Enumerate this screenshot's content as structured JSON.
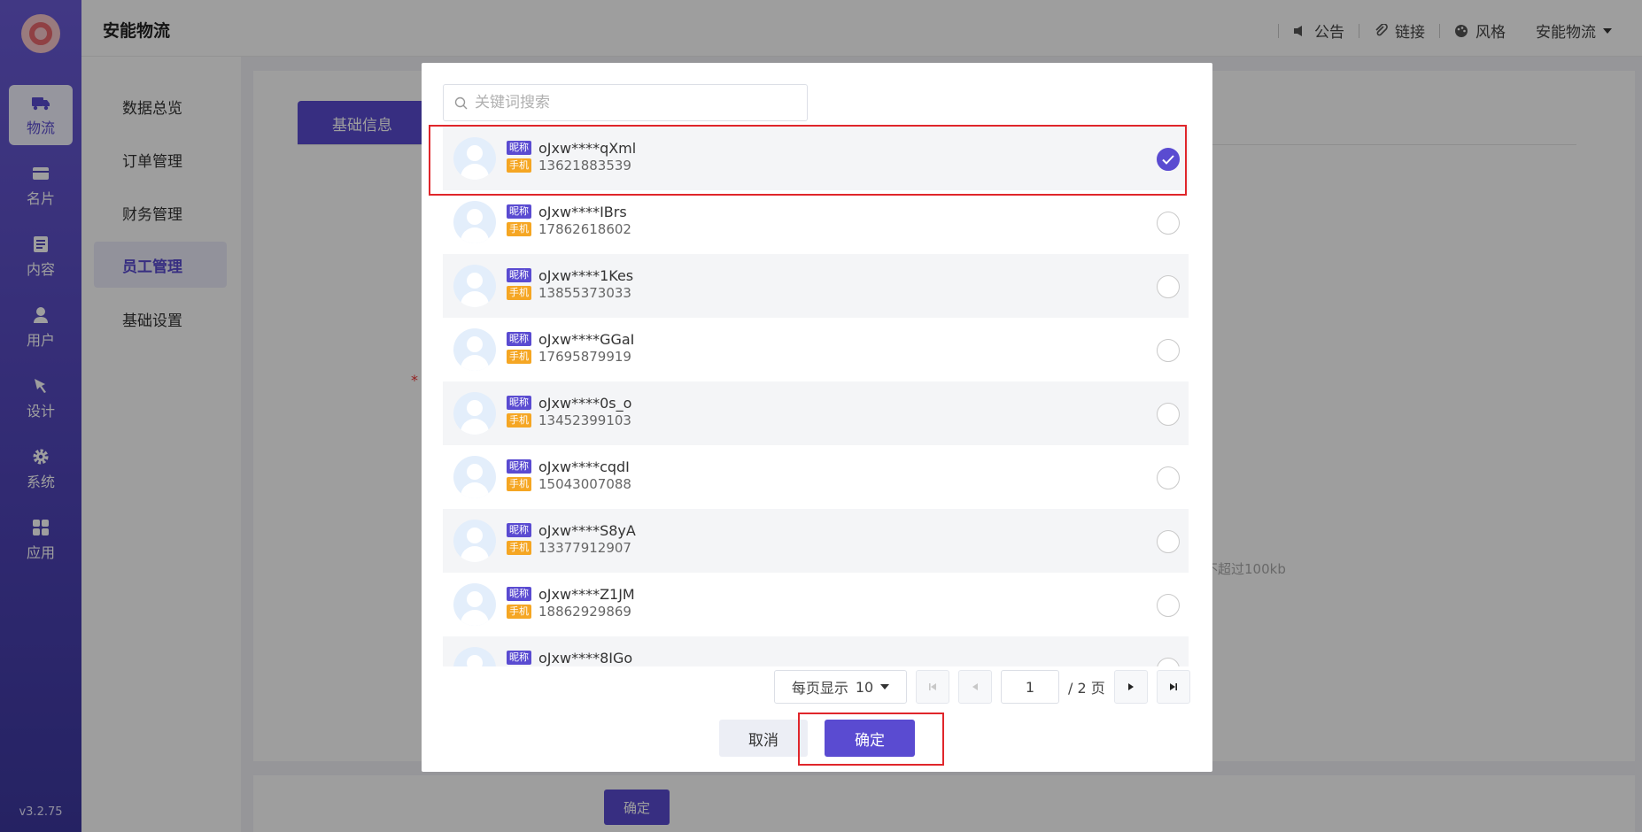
{
  "app": {
    "brand": "安能物流",
    "version": "v3.2.75"
  },
  "rail": [
    {
      "label": "物流",
      "icon": "truck-icon",
      "active": true
    },
    {
      "label": "名片",
      "icon": "card-icon"
    },
    {
      "label": "内容",
      "icon": "document-icon"
    },
    {
      "label": "用户",
      "icon": "user-icon"
    },
    {
      "label": "设计",
      "icon": "design-icon"
    },
    {
      "label": "系统",
      "icon": "gear-icon"
    },
    {
      "label": "应用",
      "icon": "apps-icon"
    }
  ],
  "submenu": [
    "数据总览",
    "订单管理",
    "财务管理",
    "员工管理",
    "基础设置"
  ],
  "submenu_active": "员工管理",
  "header": {
    "notice": "公告",
    "link": "链接",
    "style": "风格",
    "account": "安能物流"
  },
  "page": {
    "tab": "基础信息",
    "required_mark": "*",
    "hint": "不超过100kb",
    "confirm": "确定"
  },
  "modal": {
    "search_placeholder": "关键词搜索",
    "nick_tag": "昵称",
    "phone_tag": "手机",
    "users": [
      {
        "nick": "oJxw****qXml",
        "phone": "13621883539",
        "checked": true
      },
      {
        "nick": "oJxw****IBrs",
        "phone": "17862618602",
        "checked": false
      },
      {
        "nick": "oJxw****1Kes",
        "phone": "13855373033",
        "checked": false
      },
      {
        "nick": "oJxw****GGaI",
        "phone": "17695879919",
        "checked": false
      },
      {
        "nick": "oJxw****0s_o",
        "phone": "13452399103",
        "checked": false
      },
      {
        "nick": "oJxw****cqdI",
        "phone": "15043007088",
        "checked": false
      },
      {
        "nick": "oJxw****S8yA",
        "phone": "13377912907",
        "checked": false
      },
      {
        "nick": "oJxw****Z1JM",
        "phone": "18862929869",
        "checked": false
      },
      {
        "nick": "oJxw****8IGo",
        "phone": "",
        "checked": false
      }
    ],
    "pagination": {
      "per_page_label": "每页显示",
      "per_page": "10",
      "current": "1",
      "total": "/ 2 页"
    },
    "cancel": "取消",
    "ok": "确定"
  },
  "colors": {
    "accent": "#5a4bd1",
    "highlight": "#e0262b",
    "phone_tag": "#f5a623"
  }
}
